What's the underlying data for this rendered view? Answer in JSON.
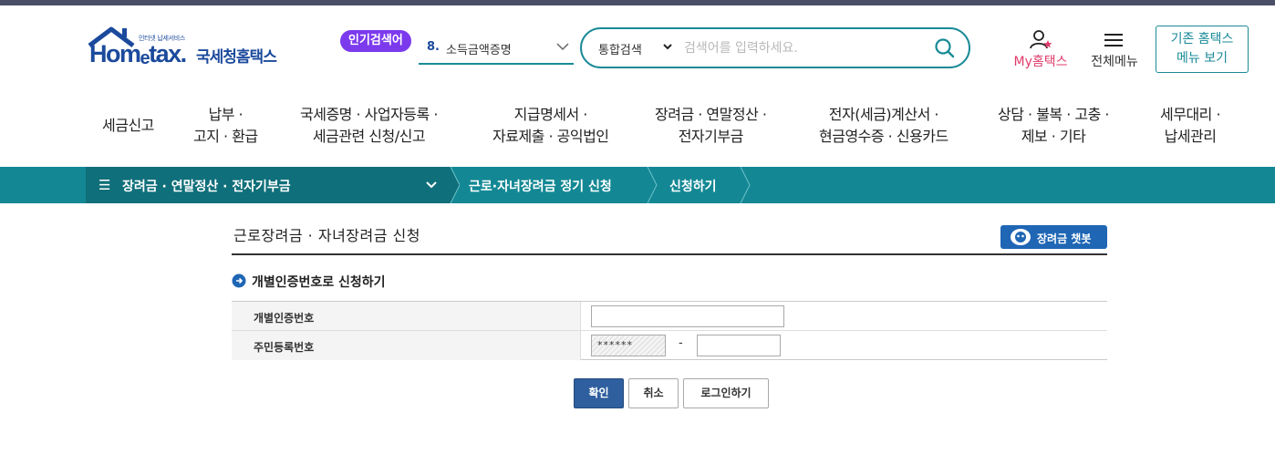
{
  "header": {
    "logo": {
      "small": "인터넷 납세서비스",
      "main_prefix": "Hom",
      "main_e": "e",
      "main_suffix": "tax.",
      "kr": "국세청홈택스"
    },
    "popular": {
      "badge": "인기검색어",
      "rank": "8.",
      "keyword": "소득금액증명"
    },
    "search": {
      "type": "통합검색",
      "placeholder": "검색어를 입력하세요."
    },
    "my_hometax": {
      "prefix": "My",
      "suffix": "홈택스"
    },
    "all_menu": "전체메뉴",
    "old_hometax": [
      "기존 홈택스",
      "메뉴 보기"
    ]
  },
  "gnb": [
    {
      "lines": [
        "세금신고"
      ]
    },
    {
      "lines": [
        "납부 ·",
        "고지 · 환급"
      ]
    },
    {
      "lines": [
        "국세증명 · 사업자등록 ·",
        "세금관련 신청/신고"
      ]
    },
    {
      "lines": [
        "지급명세서 ·",
        "자료제출 · 공익법인"
      ]
    },
    {
      "lines": [
        "장려금 · 연말정산 ·",
        "전자기부금"
      ]
    },
    {
      "lines": [
        "전자(세금)계산서 ·",
        "현금영수증 · 신용카드"
      ]
    },
    {
      "lines": [
        "상담 · 불복 · 고충 ·",
        "제보 · 기타"
      ]
    },
    {
      "lines": [
        "세무대리 ·",
        "납세관리"
      ]
    }
  ],
  "breadcrumb": {
    "first": "장려금 · 연말정산 · 전자기부금",
    "second": "근로·자녀장려금 정기 신청",
    "third": "신청하기"
  },
  "content": {
    "title": "근로장려금 · 자녀장려금 신청",
    "chatbot_label": "장려금 챗봇",
    "section_title": "개별인증번호로 신청하기",
    "rows": [
      {
        "label": "개별인증번호",
        "value": ""
      },
      {
        "label": "주민등록번호",
        "front_masked": "******",
        "dash": "-",
        "back": ""
      }
    ],
    "buttons": {
      "confirm": "확인",
      "cancel": "취소",
      "login": "로그인하기"
    }
  },
  "colors": {
    "teal": "#138894",
    "teal_dark": "#0f6f7a",
    "brand_blue": "#1b4a9c",
    "badge_purple": "#7c3aed",
    "confirm_blue": "#2f5f9e",
    "my_pink": "#e03b6b"
  }
}
